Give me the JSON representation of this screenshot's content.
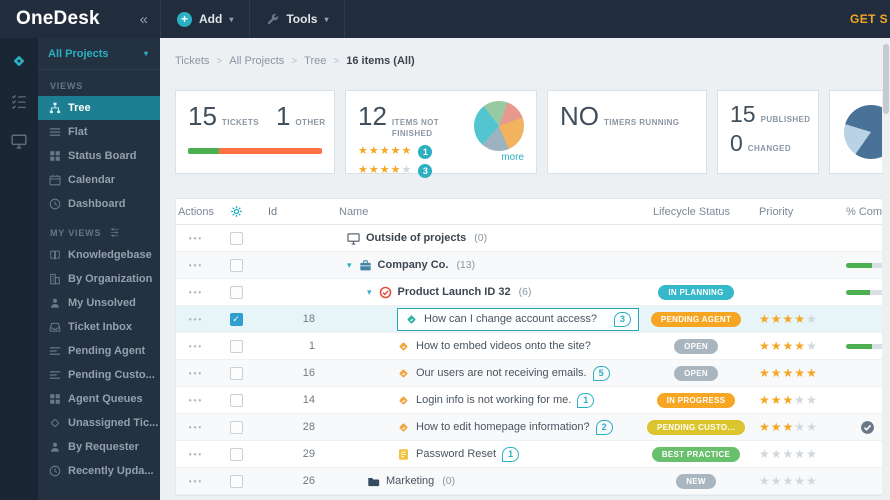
{
  "colors": {
    "accent_teal": "#2ab0c2",
    "navy": "#212d3c",
    "star_on": "#f5a623",
    "star_off": "#d0d7dd",
    "progress_green": "#4cb050",
    "status_colors": {
      "teal": "#35b9ca",
      "orange": "#f6a623",
      "gray": "#a9b6bf",
      "yellow": "#dcc42c",
      "green": "#68c06d"
    }
  },
  "topbar": {
    "logo": "OneDesk",
    "collapse": "«",
    "add": "Add",
    "tools": "Tools",
    "get_started": "GET S"
  },
  "app_strip": [
    {
      "icon": "tickets-app-icon",
      "active": true
    },
    {
      "icon": "tasks-app-icon"
    },
    {
      "icon": "monitor-app-icon"
    }
  ],
  "sidebar": {
    "project_selector": "All Projects",
    "sections": [
      {
        "header": "VIEWS",
        "items": [
          {
            "label": "Tree",
            "icon": "tree-icon",
            "active": true
          },
          {
            "label": "Flat",
            "icon": "flat-icon"
          },
          {
            "label": "Status Board",
            "icon": "board-icon"
          },
          {
            "label": "Calendar",
            "icon": "calendar-icon"
          },
          {
            "label": "Dashboard",
            "icon": "dashboard-icon"
          }
        ]
      },
      {
        "header": "MY VIEWS",
        "header_icon": "myviews-icon",
        "items": [
          {
            "label": "Knowledgebase",
            "icon": "knowledgebase-icon"
          },
          {
            "label": "By Organization",
            "icon": "organization-icon"
          },
          {
            "label": "My Unsolved",
            "icon": "unsolved-icon"
          },
          {
            "label": "Ticket Inbox",
            "icon": "inbox-icon"
          },
          {
            "label": "Pending Agent",
            "icon": "pending-agent-icon"
          },
          {
            "label": "Pending Custo...",
            "icon": "pending-customer-icon"
          },
          {
            "label": "Agent Queues",
            "icon": "queues-icon"
          },
          {
            "label": "Unassigned Tic...",
            "icon": "unassigned-icon"
          },
          {
            "label": "By Requester",
            "icon": "requester-icon"
          },
          {
            "label": "Recently Upda...",
            "icon": "recent-icon"
          }
        ]
      }
    ]
  },
  "breadcrumb": {
    "separator": ">",
    "items": [
      {
        "label": "Tickets"
      },
      {
        "label": "All Projects"
      },
      {
        "label": "Tree"
      },
      {
        "label": "16 items (All)",
        "current": true
      }
    ]
  },
  "cards": {
    "tickets": {
      "count": "15",
      "label": "TICKETS",
      "other_count": "1",
      "other_label": "OTHER",
      "progress": [
        {
          "color": "#4cb050",
          "pct": 23
        },
        {
          "color": "#ff7043",
          "pct": 77
        }
      ]
    },
    "not_finished": {
      "count": "12",
      "label": "ITEMS NOT FINISHED",
      "ratings": [
        {
          "stars": 5,
          "count": "1"
        },
        {
          "stars": 4,
          "count": "3"
        }
      ],
      "more": "more",
      "pie": [
        {
          "color": "#e8998f",
          "value": 14
        },
        {
          "color": "#f2b25e",
          "value": 24
        },
        {
          "color": "#9db3c2",
          "value": 18
        },
        {
          "color": "#52c5d0",
          "value": 28
        },
        {
          "color": "#97c9a3",
          "value": 16
        }
      ]
    },
    "timers": {
      "count": "NO",
      "label": "TIMERS RUNNING"
    },
    "published": {
      "count": "15",
      "label": "PUBLISHED",
      "changed": "0",
      "changed_label": "CHANGED"
    },
    "pie_card": {
      "slices": [
        {
          "color": "#b9d2e6",
          "value": 20
        },
        {
          "color": "#4a7298",
          "value": 80
        }
      ]
    }
  },
  "table": {
    "headers": {
      "actions": "Actions",
      "id": "Id",
      "name": "Name",
      "status": "Lifecycle Status",
      "priority": "Priority",
      "complete": "% Complete"
    },
    "rows": [
      {
        "name": "Outside of projects",
        "count": "(0)",
        "icon": "desktop-icon",
        "level": 1,
        "group": true
      },
      {
        "name": "Company Co.",
        "count": "(13)",
        "icon": "briefcase-icon",
        "level": 1,
        "expanded": true,
        "group": true,
        "progress": 62
      },
      {
        "name": "Product Launch ID 32",
        "count": "(6)",
        "icon": "project-icon",
        "level": 2,
        "expanded": true,
        "group": true,
        "status": "IN PLANNING",
        "status_color": "teal",
        "progress": 58
      },
      {
        "id": "18",
        "name": "How can I change account access?",
        "icon": "ticket-icon",
        "icon_tone": "teal",
        "level": 3,
        "conversations": "3",
        "status": "PENDING AGENT",
        "status_color": "orange",
        "stars": 4,
        "checked": true,
        "selected": true
      },
      {
        "id": "1",
        "name": "How to embed videos onto the site?",
        "icon": "ticket-icon",
        "icon_tone": "orange",
        "level": 3,
        "status": "OPEN",
        "status_color": "gray",
        "stars": 4,
        "progress": 62
      },
      {
        "id": "16",
        "name": "Our users are not receiving emails.",
        "icon": "ticket-icon",
        "icon_tone": "orange",
        "level": 3,
        "conversations": "5",
        "status": "OPEN",
        "status_color": "gray",
        "stars": 5
      },
      {
        "id": "14",
        "name": "Login info is not working for me.",
        "icon": "ticket-icon",
        "icon_tone": "orange",
        "level": 3,
        "conversations": "1",
        "status": "IN PROGRESS",
        "status_color": "orange",
        "stars": 3
      },
      {
        "id": "28",
        "name": "How to edit homepage information?",
        "icon": "ticket-icon",
        "icon_tone": "orange",
        "level": 3,
        "conversations": "2",
        "status": "PENDING CUSTO...",
        "status_color": "yellow",
        "stars": 3,
        "complete_check": true
      },
      {
        "id": "29",
        "name": "Password Reset",
        "icon": "article-icon",
        "level": 3,
        "conversations": "1",
        "status": "BEST PRACTICE",
        "status_color": "green",
        "stars": 0
      },
      {
        "id": "26",
        "name": "Marketing",
        "count": "(0)",
        "icon": "folder-icon",
        "level": 2,
        "status": "NEW",
        "status_color": "gray",
        "stars": 0
      }
    ]
  }
}
